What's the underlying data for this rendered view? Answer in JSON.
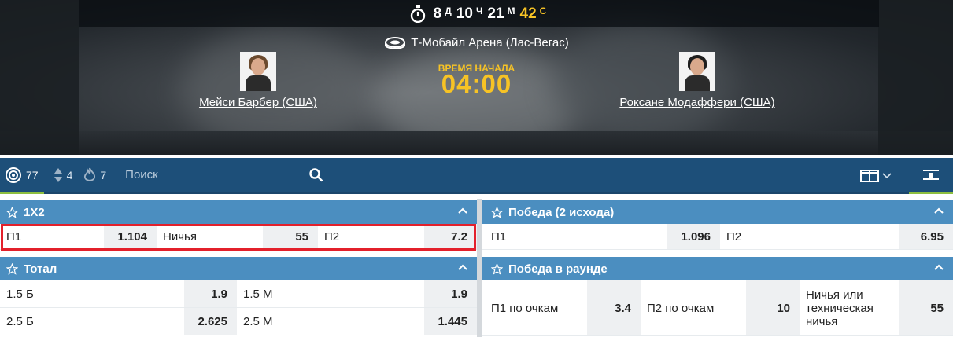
{
  "timer": {
    "days": "8",
    "days_unit": "Д",
    "hours": "10",
    "hours_unit": "Ч",
    "minutes": "21",
    "minutes_unit": "М",
    "seconds": "42",
    "seconds_unit": "С",
    "icon": "stopwatch-icon"
  },
  "event": {
    "arena": "Т-Мобайл Арена (Лас-Вегас)",
    "arena_icon": "stadium-icon",
    "start_label": "ВРЕМЯ НАЧАЛА",
    "start_time": "04:00",
    "fighter1": "Мейси Барбер (США)",
    "fighter2": "Роксане Модаффери (США)"
  },
  "toolbar": {
    "all_count": "77",
    "updown_count": "4",
    "hot_count": "7",
    "search_placeholder": "Поиск"
  },
  "colors": {
    "accent_yellow": "#f7c325",
    "toolbar_bg": "#1d4f79",
    "market_header": "#4b8ec0",
    "highlight_red": "#e3202b",
    "active_green": "#8dbf3f"
  },
  "markets": {
    "m1x2": {
      "title": "1X2",
      "rows": [
        {
          "l1": "П1",
          "o1": "1.104",
          "l2": "Ничья",
          "o2": "55",
          "l3": "П2",
          "o3": "7.2"
        }
      ]
    },
    "win2": {
      "title": "Победа (2 исхода)",
      "rows": [
        {
          "l1": "П1",
          "o1": "1.096",
          "l2": "П2",
          "o2": "6.95"
        }
      ]
    },
    "total": {
      "title": "Тотал",
      "rows": [
        {
          "l1": "1.5 Б",
          "o1": "1.9",
          "l2": "1.5 М",
          "o2": "1.9"
        },
        {
          "l1": "2.5 Б",
          "o1": "2.625",
          "l2": "2.5 М",
          "o2": "1.445"
        }
      ]
    },
    "round": {
      "title": "Победа в раунде",
      "rows": [
        {
          "l1": "П1 по очкам",
          "o1": "3.4",
          "l2": "П2 по очкам",
          "o2": "10",
          "l3": "Ничья или техническая ничья",
          "o3": "55"
        }
      ]
    }
  }
}
